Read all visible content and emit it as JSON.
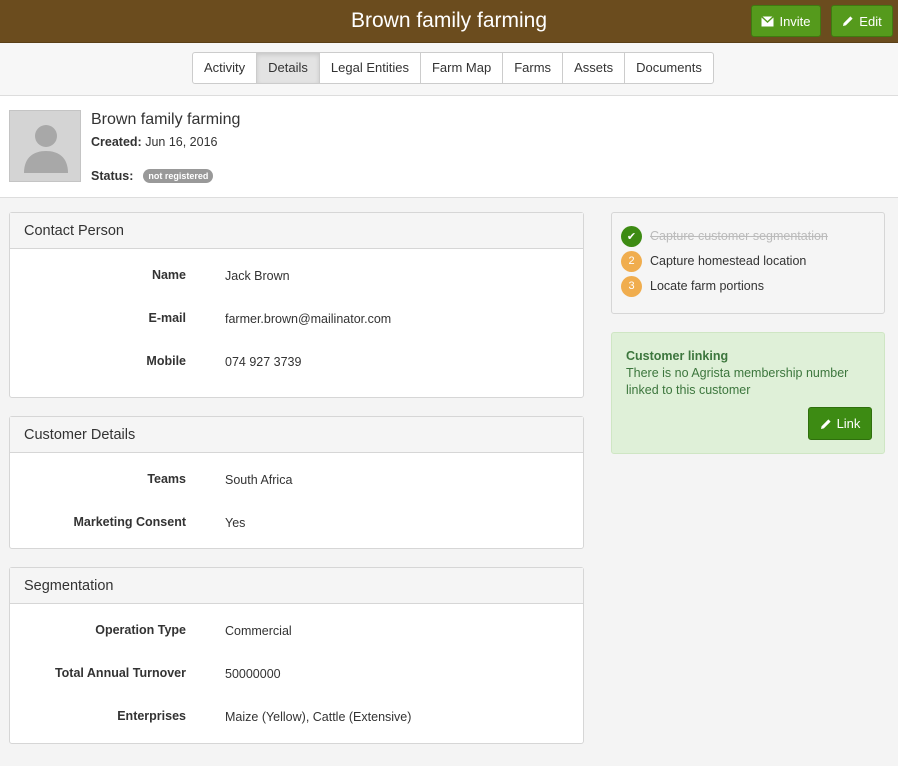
{
  "header": {
    "title": "Brown family farming",
    "invite_label": "Invite",
    "edit_label": "Edit"
  },
  "tabs": [
    {
      "label": "Activity"
    },
    {
      "label": "Details"
    },
    {
      "label": "Legal Entities"
    },
    {
      "label": "Farm Map"
    },
    {
      "label": "Farms"
    },
    {
      "label": "Assets"
    },
    {
      "label": "Documents"
    }
  ],
  "customer": {
    "name": "Brown family farming",
    "created_label": "Created:",
    "created_value": "Jun 16, 2016",
    "status_label": "Status:",
    "status_value": "not registered"
  },
  "contact": {
    "title": "Contact Person",
    "rows": [
      {
        "label": "Name",
        "value": "Jack Brown"
      },
      {
        "label": "E-mail",
        "value": "farmer.brown@mailinator.com"
      },
      {
        "label": "Mobile",
        "value": "074 927 3739"
      }
    ]
  },
  "details": {
    "title": "Customer Details",
    "rows": [
      {
        "label": "Teams",
        "value": "South Africa"
      },
      {
        "label": "Marketing Consent",
        "value": "Yes"
      }
    ]
  },
  "segmentation": {
    "title": "Segmentation",
    "rows": [
      {
        "label": "Operation Type",
        "value": "Commercial"
      },
      {
        "label": "Total Annual Turnover",
        "value": "50000000"
      },
      {
        "label": "Enterprises",
        "value": "Maize (Yellow), Cattle (Extensive)"
      }
    ]
  },
  "todo": {
    "items": [
      {
        "number": "✔",
        "label": "Capture customer segmentation",
        "done": true
      },
      {
        "number": "2",
        "label": "Capture homestead location",
        "done": false
      },
      {
        "number": "3",
        "label": "Locate farm portions",
        "done": false
      }
    ]
  },
  "linking": {
    "title": "Customer linking",
    "text": "There is no Agrista membership number linked to this customer",
    "button_label": "Link"
  },
  "colors": {
    "topbar": "#6b4c1e",
    "action_green": "#559a1c",
    "done_green": "#3d8b13",
    "pending_orange": "#f0ad4e"
  }
}
